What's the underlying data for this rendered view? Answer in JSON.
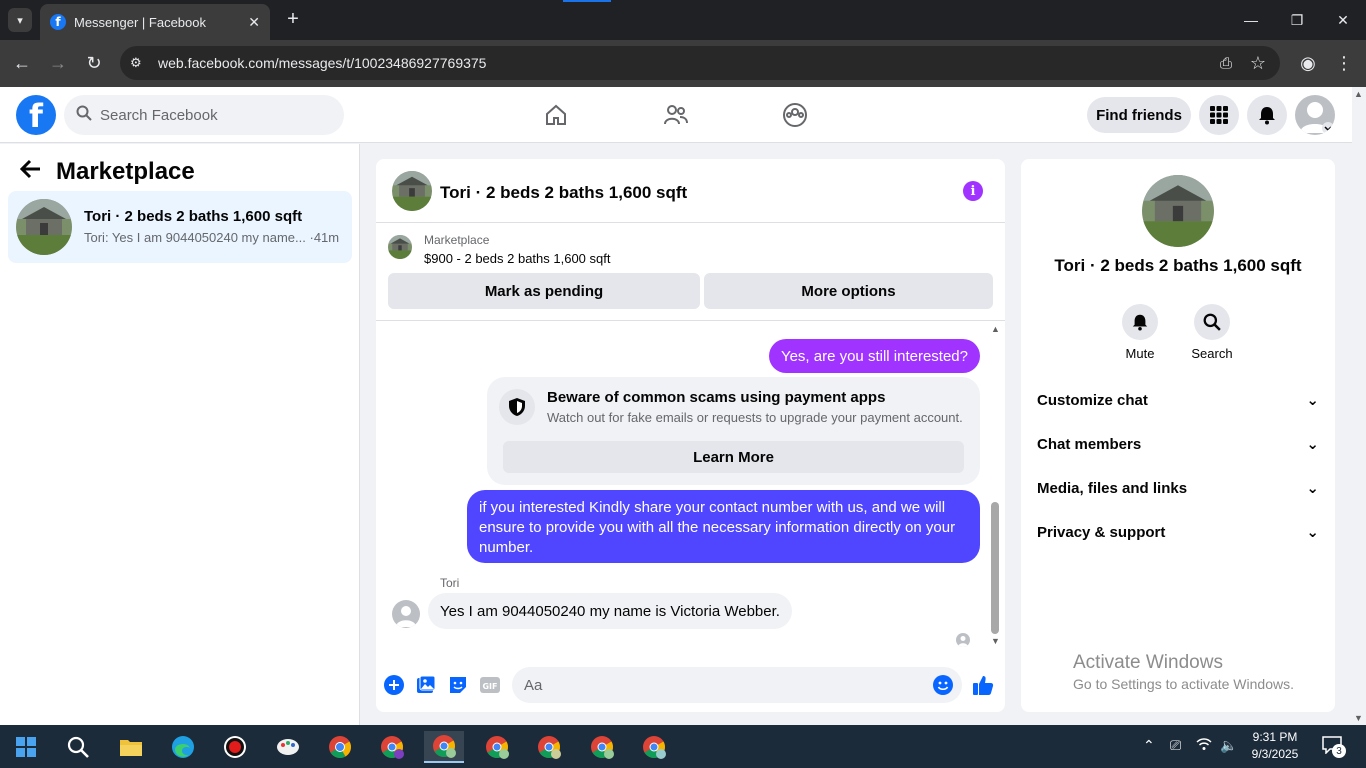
{
  "browser": {
    "tab_title": "Messenger | Facebook",
    "new_tab": "+",
    "url": "web.facebook.com/messages/t/10023486927769375"
  },
  "header": {
    "search_placeholder": "Search Facebook",
    "find_friends": "Find friends"
  },
  "sidebar": {
    "title": "Marketplace",
    "conversation": {
      "name": "Tori · 2 beds 2 baths 1,600 sqft",
      "snippet": "Tori: Yes I am 9044050240 my name...",
      "time": "·41m"
    }
  },
  "chat": {
    "title": "Tori · 2 beds 2 baths 1,600 sqft",
    "marketplace_label": "Marketplace",
    "listing": "$900 - 2 beds 2 baths 1,600 sqft",
    "mark_pending": "Mark as pending",
    "more_options": "More options",
    "messages": {
      "out1": "Yes, are you still interested?",
      "scam_title": "Beware of common scams using payment apps",
      "scam_desc": "Watch out for fake emails or requests to upgrade your payment account.",
      "learn_more": "Learn More",
      "out2": "if you interested Kindly share your contact number with us, and we will ensure to provide you with all the necessary information directly on your number.",
      "sender": "Tori",
      "in1": "Yes I am 9044050240 my name is Victoria Webber."
    },
    "composer_placeholder": "Aa"
  },
  "rightpane": {
    "name": "Tori · 2 beds 2 baths 1,600 sqft",
    "mute": "Mute",
    "search": "Search",
    "rows": [
      "Customize chat",
      "Chat members",
      "Media, files and links",
      "Privacy & support"
    ]
  },
  "watermark": {
    "line1": "Activate Windows",
    "line2": "Go to Settings to activate Windows."
  },
  "taskbar": {
    "time": "9:31 PM",
    "date": "9/3/2025",
    "notifications": "3"
  },
  "colors": {
    "fb_blue": "#1877f2",
    "purple_bubble": "#a033ff",
    "indigo_bubble": "#5146ff",
    "selected_conv": "#ebf5ff"
  }
}
